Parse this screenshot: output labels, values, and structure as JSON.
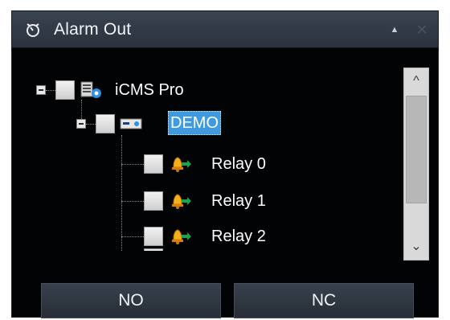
{
  "window": {
    "title": "Alarm Out",
    "title_icon": "alarm-clock-icon",
    "collapse_glyph": "▲",
    "close_glyph": "✕"
  },
  "tree": {
    "root": {
      "label": "iCMS Pro",
      "icon": "server-settings-icon",
      "expanded": true,
      "checked": false
    },
    "device": {
      "label": "DEMO",
      "icon": "device-icon",
      "expanded": true,
      "checked": false,
      "selected": true
    },
    "relays": [
      {
        "label": "Relay 0",
        "icon": "relay-bell-icon",
        "checked": false
      },
      {
        "label": "Relay 1",
        "icon": "relay-bell-icon",
        "checked": false
      },
      {
        "label": "Relay 2",
        "icon": "relay-bell-icon",
        "checked": false
      }
    ]
  },
  "scrollbar": {
    "up_glyph": "^",
    "down_glyph": "⌄"
  },
  "buttons": {
    "no_label": "NO",
    "nc_label": "NC"
  },
  "colors": {
    "selection": "#3f9be0",
    "background": "#020305",
    "titlebar": "#323a45"
  }
}
